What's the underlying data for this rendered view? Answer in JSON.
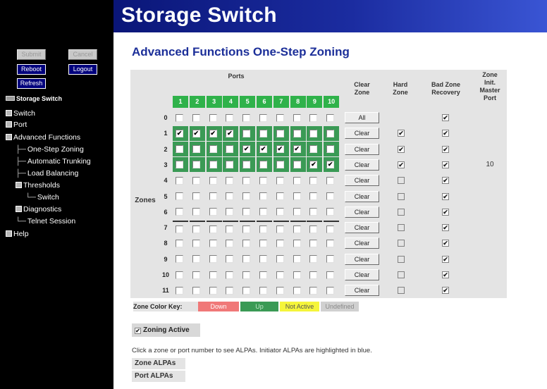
{
  "header": {
    "title": "Storage Switch"
  },
  "sidebar": {
    "buttons": {
      "submit": "Submit",
      "cancel": "Cancel",
      "reboot": "Reboot",
      "logout": "Logout",
      "refresh": "Refresh"
    },
    "tree": [
      {
        "label": "Storage Switch",
        "level": 0,
        "kind": "root"
      },
      {
        "label": "Switch",
        "level": 0,
        "kind": "node"
      },
      {
        "label": "Port",
        "level": 0,
        "kind": "node"
      },
      {
        "label": "Advanced Functions",
        "level": 0,
        "kind": "node"
      },
      {
        "label": "One-Step Zoning",
        "level": 1,
        "kind": "leaf"
      },
      {
        "label": "Automatic Trunking",
        "level": 1,
        "kind": "leaf"
      },
      {
        "label": "Load Balancing",
        "level": 1,
        "kind": "leaf"
      },
      {
        "label": "Thresholds",
        "level": 1,
        "kind": "node"
      },
      {
        "label": "Switch",
        "level": 2,
        "kind": "last-leaf"
      },
      {
        "label": "Diagnostics",
        "level": 1,
        "kind": "node"
      },
      {
        "label": "Telnet Session",
        "level": 1,
        "kind": "last-leaf"
      },
      {
        "label": "Help",
        "level": 0,
        "kind": "node"
      }
    ]
  },
  "main": {
    "title": "Advanced Functions One-Step Zoning",
    "table": {
      "ports_header": "Ports",
      "clear_zone_header": "Clear Zone",
      "hard_zone_header": "Hard Zone",
      "bad_zone_header": "Bad Zone Recovery",
      "master_header": "Zone Init. Master Port",
      "zones_label": "Zones",
      "port_numbers": [
        "1",
        "2",
        "3",
        "4",
        "5",
        "6",
        "7",
        "8",
        "9",
        "10"
      ],
      "rows": [
        {
          "zone": "0",
          "checked": [],
          "green": [],
          "clear_label": "All",
          "hard_zone": null,
          "bad_zone": true,
          "master": ""
        },
        {
          "zone": "1",
          "checked": [
            1,
            2,
            3,
            4
          ],
          "green": [
            1,
            2,
            3,
            4,
            5,
            6,
            7,
            8,
            9,
            10
          ],
          "clear_label": "Clear",
          "hard_zone": true,
          "bad_zone": true,
          "master": ""
        },
        {
          "zone": "2",
          "checked": [
            5,
            6,
            7,
            8
          ],
          "green": [
            1,
            2,
            3,
            4,
            5,
            6,
            7,
            8,
            9,
            10
          ],
          "clear_label": "Clear",
          "hard_zone": true,
          "bad_zone": true,
          "master": ""
        },
        {
          "zone": "3",
          "checked": [
            9,
            10
          ],
          "green": [
            1,
            2,
            3,
            4,
            5,
            6,
            7,
            8,
            9,
            10
          ],
          "clear_label": "Clear",
          "hard_zone": true,
          "bad_zone": true,
          "master": "10"
        },
        {
          "zone": "4",
          "checked": [],
          "green": [],
          "clear_label": "Clear",
          "hard_zone": false,
          "bad_zone": true,
          "master": ""
        },
        {
          "zone": "5",
          "checked": [],
          "green": [],
          "clear_label": "Clear",
          "hard_zone": false,
          "bad_zone": true,
          "master": ""
        },
        {
          "zone": "6",
          "checked": [],
          "green": [],
          "clear_label": "Clear",
          "hard_zone": false,
          "bad_zone": true,
          "master": ""
        },
        {
          "zone": "7",
          "checked": [],
          "green": [],
          "clear_label": "Clear",
          "hard_zone": false,
          "bad_zone": true,
          "master": ""
        },
        {
          "zone": "8",
          "checked": [],
          "green": [],
          "clear_label": "Clear",
          "hard_zone": false,
          "bad_zone": true,
          "master": ""
        },
        {
          "zone": "9",
          "checked": [],
          "green": [],
          "clear_label": "Clear",
          "hard_zone": false,
          "bad_zone": true,
          "master": ""
        },
        {
          "zone": "10",
          "checked": [],
          "green": [],
          "clear_label": "Clear",
          "hard_zone": false,
          "bad_zone": true,
          "master": ""
        },
        {
          "zone": "11",
          "checked": [],
          "green": [],
          "clear_label": "Clear",
          "hard_zone": false,
          "bad_zone": true,
          "master": ""
        }
      ]
    },
    "color_key": {
      "label": "Zone Color Key:",
      "items": [
        {
          "label": "Down",
          "bg": "#f07878",
          "fg": "#ffffff"
        },
        {
          "label": "Up",
          "bg": "#3a9a55",
          "fg": "#bfe8c8"
        },
        {
          "label": "Not Active",
          "bg": "#f5f53a",
          "fg": "#555555"
        },
        {
          "label": "Undefined",
          "bg": "#d0d0d0",
          "fg": "#8a8a8a"
        }
      ]
    },
    "zoning_active": {
      "label": "Zoning Active",
      "checked": true
    },
    "info": "Click a zone or port number to see ALPAs. Initiator ALPAs are highlighted in blue.",
    "zone_alpas": "Zone ALPAs",
    "port_alpas": "Port ALPAs"
  },
  "colors": {
    "header_blue": "#1b2ca0",
    "title_blue": "#1c2f99",
    "up_green": "#3a9a55",
    "port_green": "#2fb24a"
  }
}
